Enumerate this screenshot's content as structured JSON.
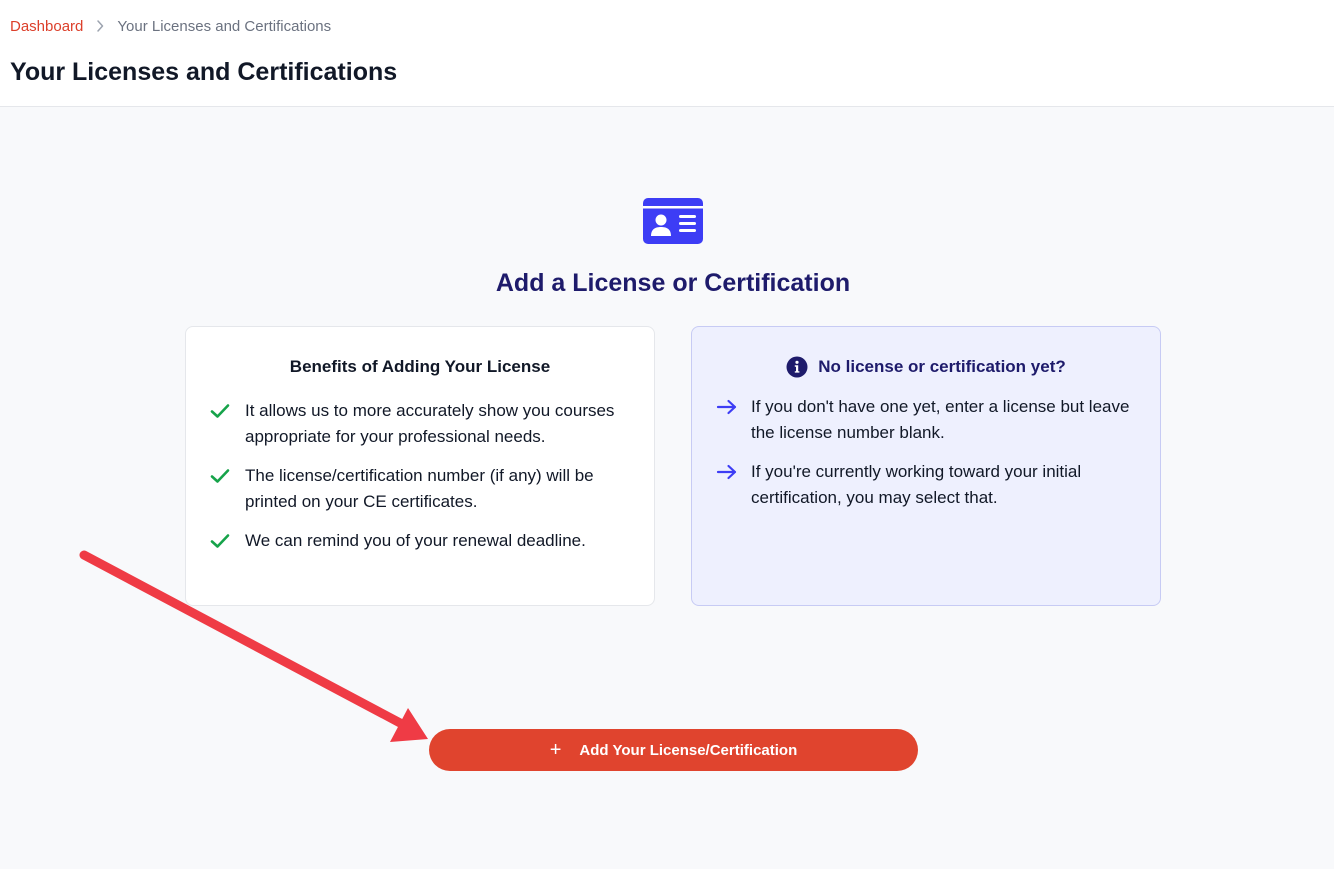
{
  "breadcrumb": {
    "home": "Dashboard",
    "current": "Your Licenses and Certifications"
  },
  "page_title": "Your Licenses and Certifications",
  "hero": {
    "icon": "id-card-icon",
    "title": "Add a License or Certification"
  },
  "benefits_card": {
    "title": "Benefits of Adding Your License",
    "items": [
      "It allows us to more accurately show you courses appropriate for your professional needs.",
      "The license/certification number (if any) will be printed on your CE certificates.",
      "We can remind you of your renewal deadline."
    ]
  },
  "info_card": {
    "icon": "info-circle-icon",
    "title": "No license or certification yet?",
    "items": [
      "If you don't have one yet, enter a license but leave the license number blank.",
      "If you're currently working toward your initial certification, you may select that."
    ]
  },
  "add_button": {
    "icon": "plus-icon",
    "label": "Add Your License/Certification"
  },
  "colors": {
    "accent": "#e0442e",
    "brand_indigo": "#3d3df5",
    "heading_navy": "#1e1b6b",
    "check_green": "#16a34a",
    "annotation_arrow": "#ef3b45"
  }
}
